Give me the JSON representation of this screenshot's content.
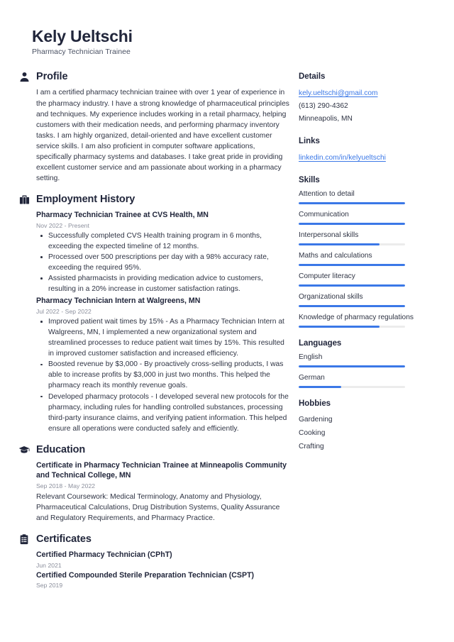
{
  "header": {
    "name": "Kely Ueltschi",
    "title": "Pharmacy Technician Trainee"
  },
  "accent_color": "#3b78e7",
  "main": {
    "profile": {
      "icon": "user-icon",
      "heading": "Profile",
      "text": "I am a certified pharmacy technician trainee with over 1 year of experience in the pharmacy industry. I have a strong knowledge of pharmaceutical principles and techniques. My experience includes working in a retail pharmacy, helping customers with their medication needs, and performing pharmacy inventory tasks. I am highly organized, detail-oriented and have excellent customer service skills. I am also proficient in computer software applications, specifically pharmacy systems and databases. I take great pride in providing excellent customer service and am passionate about working in a pharmacy setting."
    },
    "employment": {
      "icon": "briefcase-icon",
      "heading": "Employment History",
      "entries": [
        {
          "title": "Pharmacy Technician Trainee at CVS Health, MN",
          "date": "Nov 2022 - Present",
          "bullets": [
            "Successfully completed CVS Health training program in 6 months, exceeding the expected timeline of 12 months.",
            "Processed over 500 prescriptions per day with a 98% accuracy rate, exceeding the required 95%.",
            "Assisted pharmacists in providing medication advice to customers, resulting in a 20% increase in customer satisfaction ratings."
          ]
        },
        {
          "title": "Pharmacy Technician Intern at Walgreens, MN",
          "date": "Jul 2022 - Sep 2022",
          "bullets": [
            "Improved patient wait times by 15% - As a Pharmacy Technician Intern at Walgreens, MN, I implemented a new organizational system and streamlined processes to reduce patient wait times by 15%. This resulted in improved customer satisfaction and increased efficiency.",
            "Boosted revenue by $3,000 - By proactively cross-selling products, I was able to increase profits by $3,000 in just two months. This helped the pharmacy reach its monthly revenue goals.",
            "Developed pharmacy protocols - I developed several new protocols for the pharmacy, including rules for handling controlled substances, processing third-party insurance claims, and verifying patient information. This helped ensure all operations were conducted safely and efficiently."
          ]
        }
      ]
    },
    "education": {
      "icon": "graduation-cap-icon",
      "heading": "Education",
      "entries": [
        {
          "title": "Certificate in Pharmacy Technician Trainee at Minneapolis Community and Technical College, MN",
          "date": "Sep 2018 - May 2022",
          "description": "Relevant Coursework: Medical Terminology, Anatomy and Physiology, Pharmaceutical Calculations, Drug Distribution Systems, Quality Assurance and Regulatory Requirements, and Pharmacy Practice."
        }
      ]
    },
    "certificates": {
      "icon": "clipboard-icon",
      "heading": "Certificates",
      "entries": [
        {
          "title": "Certified Pharmacy Technician (CPhT)",
          "date": "Jun 2021"
        },
        {
          "title": "Certified Compounded Sterile Preparation Technician (CSPT)",
          "date": "Sep 2019"
        }
      ]
    }
  },
  "sidebar": {
    "details": {
      "heading": "Details",
      "email": "kely.ueltschi@gmail.com",
      "phone": "(613) 290-4362",
      "location": "Minneapolis, MN"
    },
    "links": {
      "heading": "Links",
      "items": [
        {
          "label": "linkedin.com/in/kelyueltschi"
        }
      ]
    },
    "skills": {
      "heading": "Skills",
      "items": [
        {
          "label": "Attention to detail",
          "level": 100
        },
        {
          "label": "Communication",
          "level": 100
        },
        {
          "label": "Interpersonal skills",
          "level": 76
        },
        {
          "label": "Maths and calculations",
          "level": 100
        },
        {
          "label": "Computer literacy",
          "level": 100
        },
        {
          "label": "Organizational skills",
          "level": 100
        },
        {
          "label": "Knowledge of pharmacy regulations",
          "level": 76
        }
      ]
    },
    "languages": {
      "heading": "Languages",
      "items": [
        {
          "label": "English",
          "level": 100
        },
        {
          "label": "German",
          "level": 40
        }
      ]
    },
    "hobbies": {
      "heading": "Hobbies",
      "items": [
        {
          "label": "Gardening"
        },
        {
          "label": "Cooking"
        },
        {
          "label": "Crafting"
        }
      ]
    }
  }
}
